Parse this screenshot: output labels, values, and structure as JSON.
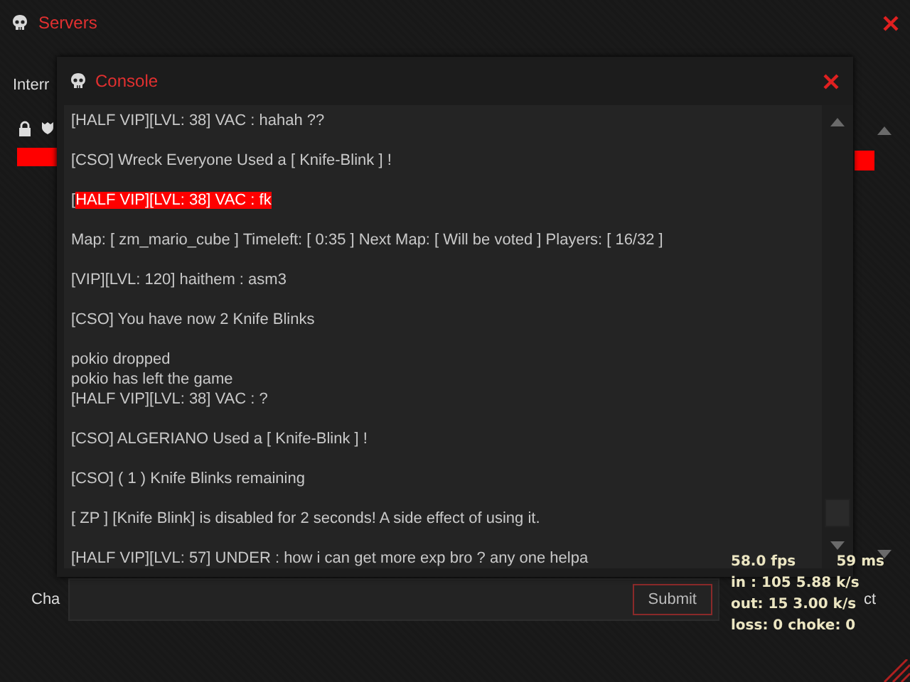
{
  "servers_window": {
    "title": "Servers",
    "tab_label": "Interr",
    "chat_label": "Cha",
    "submit_button": "Submit",
    "button_2": "ct"
  },
  "console": {
    "title": "Console",
    "blocks": [
      [
        {
          "text": "[HALF VIP][LVL: 38] VAC : hahah ??"
        }
      ],
      [
        {
          "text": "[CSO] Wreck Everyone Used a [ Knife-Blink ] !"
        }
      ],
      [
        {
          "text": "[",
          "highlight": "HALF VIP][LVL: 38] VAC : fk"
        }
      ],
      [
        {
          "text": "Map: [ zm_mario_cube ] Timeleft: [ 0:35 ] Next Map: [ Will be voted ] Players: [ 16/32 ]"
        }
      ],
      [
        {
          "text": "[VIP][LVL: 120] haithem : asm3"
        }
      ],
      [
        {
          "text": "[CSO] You have now 2 Knife Blinks"
        }
      ],
      [
        {
          "text": "pokio dropped"
        },
        {
          "text": "pokio has left the game"
        },
        {
          "text": "[HALF VIP][LVL: 38] VAC : ?"
        }
      ],
      [
        {
          "text": "[CSO] ALGERIANO Used a [ Knife-Blink ] !"
        }
      ],
      [
        {
          "text": "[CSO] ( 1 ) Knife Blinks remaining"
        }
      ],
      [
        {
          "text": "[ ZP ] [Knife Blink] is disabled for 2 seconds! A side effect of using it."
        }
      ],
      [
        {
          "text": "[HALF VIP][LVL: 57] UNDER : how i can get more exp bro ? any one helpa"
        }
      ]
    ]
  },
  "netgraph": {
    "fps": "58.0 fps",
    "ping": "59 ms",
    "in": "in :  105 5.88 k/s",
    "out": "out:  15 3.00 k/s",
    "loss": "loss: 0 choke:  0"
  }
}
